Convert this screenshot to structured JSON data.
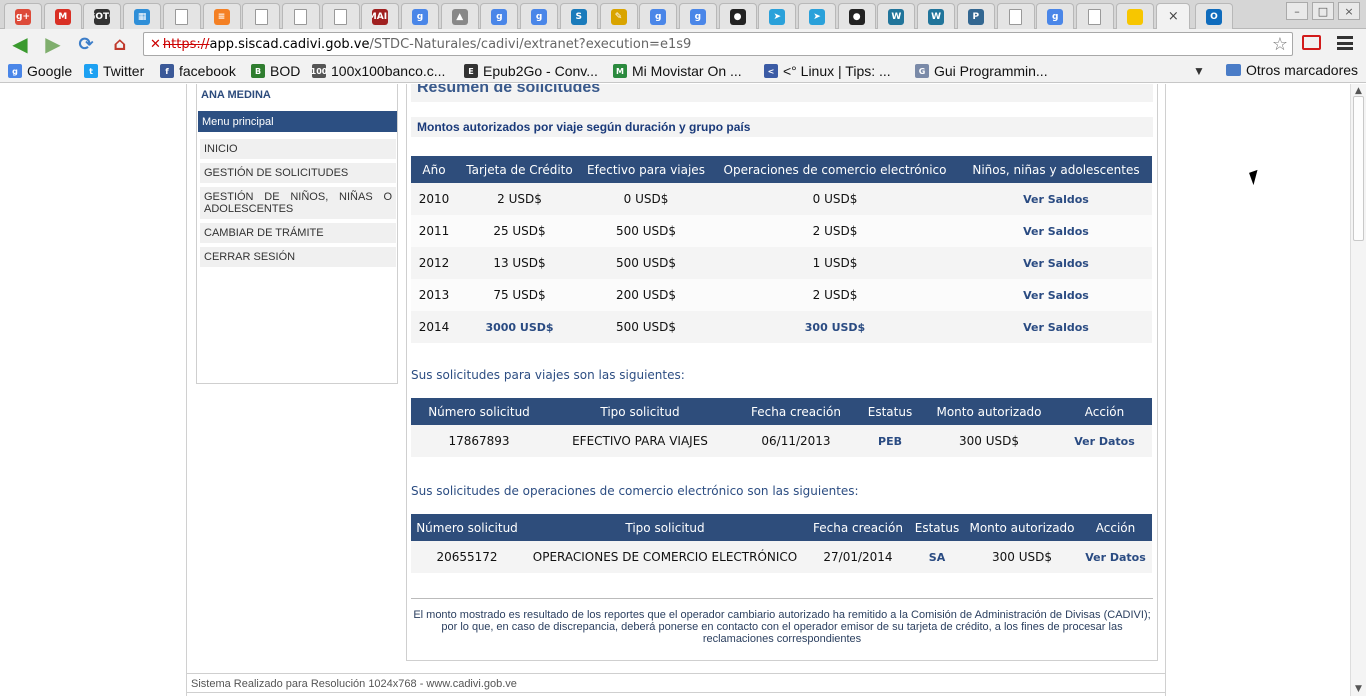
{
  "browser": {
    "tabs": [
      {
        "icon": "google-plus-icon",
        "glyph": "g+",
        "color": "#dd4b39"
      },
      {
        "icon": "gmail-icon",
        "glyph": "M",
        "color": "#d93025"
      },
      {
        "icon": "gotofritz-icon",
        "glyph": "GOTO",
        "color": "#333333"
      },
      {
        "icon": "apps-icon",
        "glyph": "▦",
        "color": "#2f8fd8"
      },
      {
        "icon": "page-icon",
        "glyph": "",
        "color": "#ffffff"
      },
      {
        "icon": "stackoverflow-icon",
        "glyph": "≡",
        "color": "#f48024"
      },
      {
        "icon": "page-icon",
        "glyph": "",
        "color": "#ffffff"
      },
      {
        "icon": "page-icon",
        "glyph": "",
        "color": "#ffffff"
      },
      {
        "icon": "page-icon",
        "glyph": "",
        "color": "#ffffff"
      },
      {
        "icon": "mailman-icon",
        "glyph": "MAIL",
        "color": "#a02020"
      },
      {
        "icon": "google-icon",
        "glyph": "g",
        "color": "#4a86e8"
      },
      {
        "icon": "tux-icon",
        "glyph": "▲",
        "color": "#888888"
      },
      {
        "icon": "google-icon",
        "glyph": "g",
        "color": "#4a86e8"
      },
      {
        "icon": "google-icon",
        "glyph": "g",
        "color": "#4a86e8"
      },
      {
        "icon": "scribd-icon",
        "glyph": "S",
        "color": "#1a7bbb"
      },
      {
        "icon": "pencil-icon",
        "glyph": "✎",
        "color": "#d9a400"
      },
      {
        "icon": "google-icon",
        "glyph": "g",
        "color": "#4a86e8"
      },
      {
        "icon": "google-icon",
        "glyph": "g",
        "color": "#4a86e8"
      },
      {
        "icon": "github-icon",
        "glyph": "●",
        "color": "#222222"
      },
      {
        "icon": "telegram-icon",
        "glyph": "➤",
        "color": "#2aa1da"
      },
      {
        "icon": "telegram-icon",
        "glyph": "➤",
        "color": "#2aa1da"
      },
      {
        "icon": "github-icon",
        "glyph": "●",
        "color": "#222222"
      },
      {
        "icon": "wordpress-icon",
        "glyph": "W",
        "color": "#21759b"
      },
      {
        "icon": "wordpress-icon",
        "glyph": "W",
        "color": "#21759b"
      },
      {
        "icon": "postgresql-icon",
        "glyph": "P",
        "color": "#336791"
      },
      {
        "icon": "page-icon",
        "glyph": "",
        "color": "#ffffff"
      },
      {
        "icon": "google-icon",
        "glyph": "g",
        "color": "#4a86e8"
      },
      {
        "icon": "page-icon",
        "glyph": "",
        "color": "#ffffff"
      },
      {
        "icon": "venezuela-flag-icon",
        "glyph": "",
        "color": "#f7c600"
      }
    ],
    "active_tab_close": "×",
    "url": {
      "scheme": "https://",
      "host": "app.siscad.cadivi.gob.ve",
      "path": "/STDC-Naturales/cadivi/extranet?execution=e1s9"
    },
    "bookmarks": [
      {
        "label": "Google",
        "icon": "google-icon",
        "glyph": "g",
        "color": "#4a86e8"
      },
      {
        "label": "Twitter",
        "icon": "twitter-icon",
        "glyph": "t",
        "color": "#1da1f2"
      },
      {
        "label": "facebook",
        "icon": "facebook-icon",
        "glyph": "f",
        "color": "#3b5998"
      },
      {
        "label": "BOD",
        "icon": "bod-icon",
        "glyph": "B",
        "color": "#2f7d2f"
      },
      {
        "label": "100x100banco.c...",
        "icon": "bank-icon",
        "glyph": "100",
        "color": "#555555"
      },
      {
        "label": "Epub2Go - Conv...",
        "icon": "epub-icon",
        "glyph": "E",
        "color": "#333333"
      },
      {
        "label": "Mi Movistar On ...",
        "icon": "movistar-icon",
        "glyph": "M",
        "color": "#2b8a3e"
      },
      {
        "label": "<° Linux | Tips: ...",
        "icon": "linux-tips-icon",
        "glyph": "<",
        "color": "#3b5ba5"
      },
      {
        "label": "Gui Programmin...",
        "icon": "gui-icon",
        "glyph": "G",
        "color": "#7a8aa8"
      }
    ],
    "other_bookmarks": "Otros marcadores"
  },
  "sidebar": {
    "user_name": "ANA MEDINA",
    "menu_title": "Menu principal",
    "items": [
      {
        "label": "INICIO"
      },
      {
        "label": "GESTIÓN DE SOLICITUDES"
      },
      {
        "label": "GESTIÓN DE NIÑOS, NIÑAS O ADOLESCENTES"
      },
      {
        "label": "CAMBIAR DE TRÁMITE"
      },
      {
        "label": "CERRAR SESIÓN"
      }
    ]
  },
  "summary": {
    "title": "Resumen de solicitudes",
    "subtitle": "Montos autorizados por viaje según duración y grupo país",
    "headers": [
      "Año",
      "Tarjeta de Crédito",
      "Efectivo para viajes",
      "Operaciones de comercio electrónico",
      "Niños, niñas y adolescentes"
    ],
    "rows": [
      {
        "year": "2010",
        "credit": "2 USD$",
        "cash": "0 USD$",
        "ecommerce": "0 USD$",
        "minors": "Ver Saldos",
        "credit_link": false,
        "ecommerce_link": false
      },
      {
        "year": "2011",
        "credit": "25 USD$",
        "cash": "500 USD$",
        "ecommerce": "2 USD$",
        "minors": "Ver Saldos",
        "credit_link": false,
        "ecommerce_link": false
      },
      {
        "year": "2012",
        "credit": "13 USD$",
        "cash": "500 USD$",
        "ecommerce": "1 USD$",
        "minors": "Ver Saldos",
        "credit_link": false,
        "ecommerce_link": false
      },
      {
        "year": "2013",
        "credit": "75 USD$",
        "cash": "200 USD$",
        "ecommerce": "2 USD$",
        "minors": "Ver Saldos",
        "credit_link": false,
        "ecommerce_link": false
      },
      {
        "year": "2014",
        "credit": "3000 USD$",
        "cash": "500 USD$",
        "ecommerce": "300 USD$",
        "minors": "Ver Saldos",
        "credit_link": true,
        "ecommerce_link": true
      }
    ]
  },
  "travel": {
    "intro": "Sus solicitudes para viajes son las siguientes:",
    "headers": [
      "Número solicitud",
      "Tipo solicitud",
      "Fecha creación",
      "Estatus",
      "Monto autorizado",
      "Acción"
    ],
    "rows": [
      {
        "number": "17867893",
        "type": "EFECTIVO PARA VIAJES",
        "date": "06/11/2013",
        "status": "PEB",
        "amount": "300 USD$",
        "action": "Ver Datos"
      }
    ]
  },
  "ecommerce": {
    "intro": "Sus solicitudes de operaciones de comercio electrónico son las siguientes:",
    "headers": [
      "Número solicitud",
      "Tipo solicitud",
      "Fecha creación",
      "Estatus",
      "Monto autorizado",
      "Acción"
    ],
    "rows": [
      {
        "number": "20655172",
        "type": "OPERACIONES DE COMERCIO ELECTRÓNICO",
        "date": "27/01/2014",
        "status": "SA",
        "amount": "300 USD$",
        "action": "Ver Datos"
      }
    ]
  },
  "disclaimer": "El monto mostrado es resultado de los reportes que el operador cambiario autorizado ha remitido a la Comisión de Administración de Divisas (CADIVI); por lo que, en caso de discrepancia, deberá ponerse en contacto con el operador emisor de su tarjeta de crédito, a los fines de procesar las reclamaciones correspondientes",
  "footer": "Sistema Realizado para Resolución 1024x768 - www.cadivi.gob.ve"
}
